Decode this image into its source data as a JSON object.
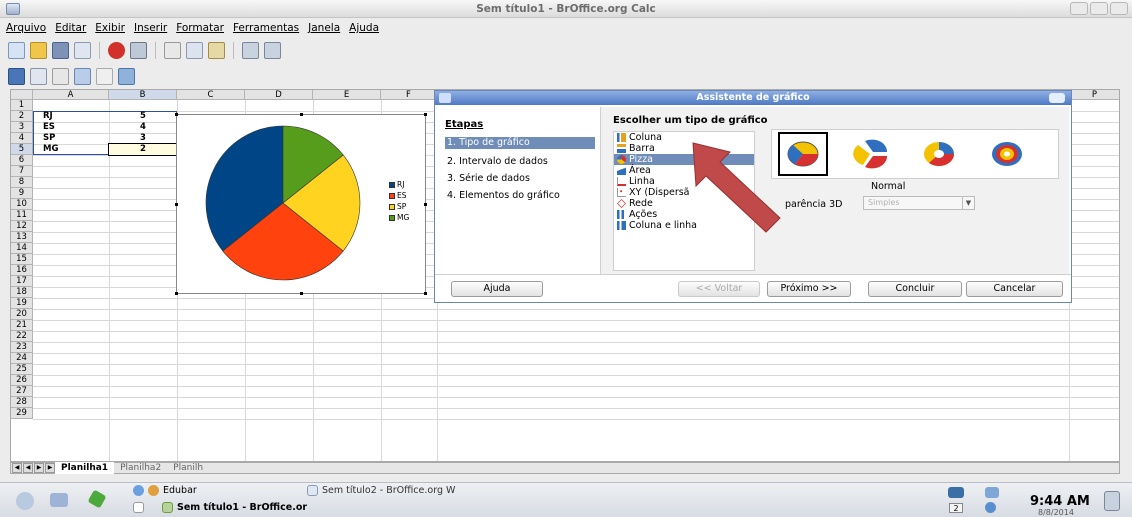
{
  "window": {
    "title": "Sem título1 - BrOffice.org Calc"
  },
  "menu": [
    "Arquivo",
    "Editar",
    "Exibir",
    "Inserir",
    "Formatar",
    "Ferramentas",
    "Janela",
    "Ajuda"
  ],
  "columns": [
    "A",
    "B",
    "C",
    "D",
    "E",
    "F",
    "P"
  ],
  "rows": [
    "1",
    "2",
    "3",
    "4",
    "5",
    "6",
    "7",
    "8",
    "9",
    "10",
    "11",
    "12",
    "13",
    "14",
    "15",
    "16",
    "17",
    "18",
    "19",
    "20",
    "21",
    "22",
    "23",
    "24",
    "25",
    "26",
    "27",
    "28",
    "29"
  ],
  "cells": {
    "a2": "RJ",
    "b2": "5",
    "a3": "ES",
    "b3": "4",
    "a4": "SP",
    "b4": "3",
    "a5": "MG",
    "b5": "2"
  },
  "chart_data": {
    "type": "pie",
    "categories": [
      "RJ",
      "ES",
      "SP",
      "MG"
    ],
    "values": [
      5,
      4,
      3,
      2
    ],
    "colors": [
      "#004586",
      "#ff420e",
      "#ffd320",
      "#579d1c"
    ],
    "legend_position": "right"
  },
  "sheet_tabs": [
    "Planilha1",
    "Planilha2",
    "Planilh"
  ],
  "dialog": {
    "title": "Assistente de gráfico",
    "steps_heading": "Etapas",
    "steps": [
      "1. Tipo de gráfico",
      "2. Intervalo de dados",
      "3. Série de dados",
      "4. Elementos do gráfico"
    ],
    "type_heading": "Escolher um tipo de gráfico",
    "types": [
      "Coluna",
      "Barra",
      "Pizza",
      "Área",
      "Linha",
      "XY (Dispersã",
      "Rede",
      "Ações",
      "Coluna e linha"
    ],
    "selected_type": "Pizza",
    "variant_label": "Normal",
    "look3d_label": "parência 3D",
    "look3d_value": "Simples",
    "buttons": {
      "help": "Ajuda",
      "back": "<< Voltar",
      "next": "Próximo >>",
      "finish": "Concluir",
      "cancel": "Cancelar"
    }
  },
  "taskbar": {
    "items": [
      "Edubar",
      "Sem título2 - BrOffice.org W",
      "Sem título1 - BrOffice.or"
    ],
    "clock": "9:44 AM",
    "date": "8/8/2014",
    "badge": "2"
  }
}
